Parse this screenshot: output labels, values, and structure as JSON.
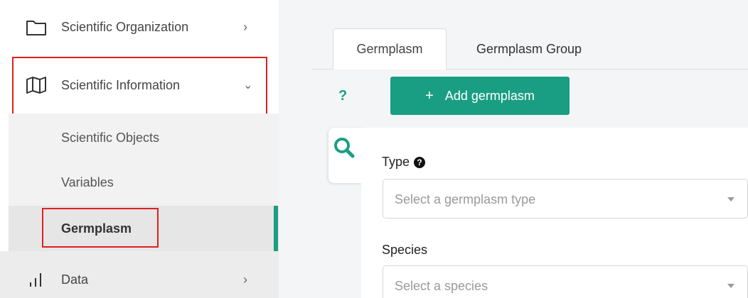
{
  "sidebar": {
    "org_label": "Scientific Organization",
    "info_label": "Scientific Information",
    "sub_items": [
      "Scientific Objects",
      "Variables",
      "Germplasm"
    ],
    "data_label": "Data"
  },
  "tabs": [
    {
      "label": "Germplasm",
      "active": true
    },
    {
      "label": "Germplasm Group",
      "active": false
    }
  ],
  "toolbar": {
    "help": "?",
    "add_label": "Add germplasm"
  },
  "filters": {
    "type_label": "Type",
    "type_placeholder": "Select a germplasm type",
    "species_label": "Species",
    "species_placeholder": "Select a species"
  },
  "colors": {
    "accent": "#1a9e83",
    "highlight": "#e02020"
  }
}
